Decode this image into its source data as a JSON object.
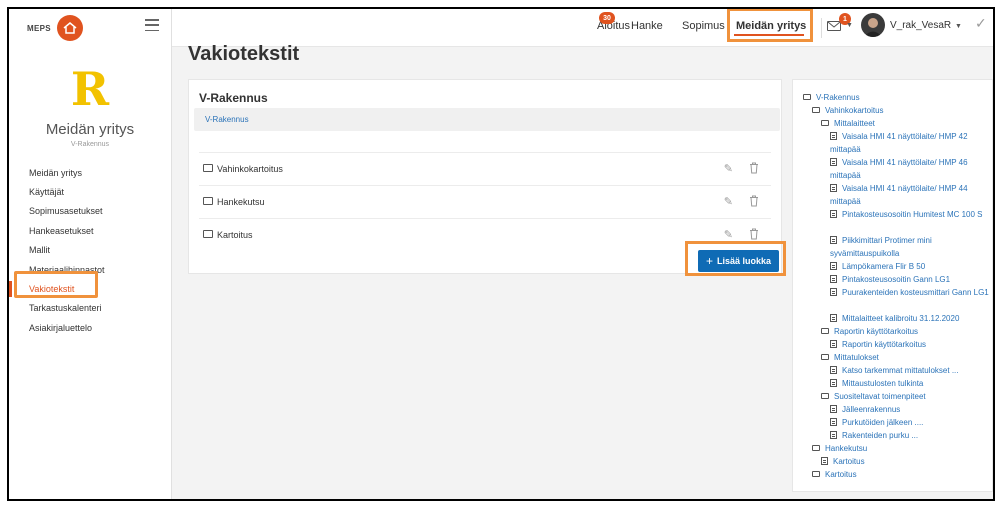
{
  "sidebar": {
    "logo_text": "MEPS",
    "company_letter": "R",
    "company_name": "Meidän yritys",
    "company_sub": "V-Rakennus",
    "items": [
      {
        "label": "Meidän yritys"
      },
      {
        "label": "Käyttäjät"
      },
      {
        "label": "Sopimusasetukset"
      },
      {
        "label": "Hankeasetukset"
      },
      {
        "label": "Mallit"
      },
      {
        "label": "Materiaalihinnastot"
      },
      {
        "label": "Vakiotekstit"
      },
      {
        "label": "Tarkastuskalenteri"
      },
      {
        "label": "Asiakirjaluettelo"
      }
    ],
    "active_index": 6
  },
  "topnav": {
    "items": [
      {
        "label": "Aloitus",
        "badge": "30"
      },
      {
        "label": "Hanke"
      },
      {
        "label": "Sopimus"
      },
      {
        "label": "Meidän yritys"
      }
    ],
    "mail_badge": "1",
    "user_name": "V_rak_VesaR"
  },
  "page": {
    "title": "Vakiotekstit"
  },
  "card": {
    "title": "V-Rakennus",
    "breadcrumb": "V-Rakennus",
    "rows": [
      {
        "label": "Vahinkokartoitus"
      },
      {
        "label": "Hankekutsu"
      },
      {
        "label": "Kartoitus"
      }
    ],
    "add_button": "Lisää luokka",
    "add_icon": "+"
  },
  "tree": {
    "nodes": [
      {
        "label": "V-Rakennus",
        "type": "folder"
      },
      {
        "label": "Vahinkokartoitus",
        "type": "folder"
      },
      {
        "label": "Mittalaitteet",
        "type": "folder"
      },
      {
        "label": "Vaisala HMI 41 näyttölaite/ HMP 42 mittapää",
        "type": "doc"
      },
      {
        "label": "Vaisala HMI 41 näyttölaite/ HMP 46 mittapää",
        "type": "doc"
      },
      {
        "label": "Vaisala HMI 41 näyttölaite/ HMP 44 mittapää",
        "type": "doc"
      },
      {
        "label": "Pintakosteusosoitin Humitest MC 100 S",
        "type": "doc"
      },
      {
        "label": "Piikkimittari Protimer mini syvämittauspuikolla",
        "type": "doc"
      },
      {
        "label": "Lämpökamera Flir B 50",
        "type": "doc"
      },
      {
        "label": "Pintakosteusosoitin Gann LG1",
        "type": "doc"
      },
      {
        "label": "Puurakenteiden kosteusmittari Gann LG1",
        "type": "doc"
      },
      {
        "label": "Mittalaitteet kalibroitu 31.12.2020",
        "type": "doc"
      },
      {
        "label": "Raportin käyttötarkoitus",
        "type": "folder"
      },
      {
        "label": "Raportin käyttötarkoitus",
        "type": "doc"
      },
      {
        "label": "Mittatulokset",
        "type": "folder"
      },
      {
        "label": "Katso tarkemmat mittatulokset ...",
        "type": "doc"
      },
      {
        "label": "Mittaustulosten tulkinta",
        "type": "doc"
      },
      {
        "label": "Suositeltavat toimenpiteet",
        "type": "folder"
      },
      {
        "label": "Jälleenrakennus",
        "type": "doc"
      },
      {
        "label": "Purkutöiden jälkeen ....",
        "type": "doc"
      },
      {
        "label": "Rakenteiden purku ...",
        "type": "doc"
      },
      {
        "label": "Hankekutsu",
        "type": "folder"
      },
      {
        "label": "Kartoitus",
        "type": "doc"
      },
      {
        "label": "Kartoitus",
        "type": "folder"
      }
    ]
  },
  "colors": {
    "accent": "#e0531f",
    "highlight": "#f0923c",
    "link": "#2b73b8",
    "primary_button": "#0f6bb5",
    "logo_letter": "#f2c200"
  }
}
